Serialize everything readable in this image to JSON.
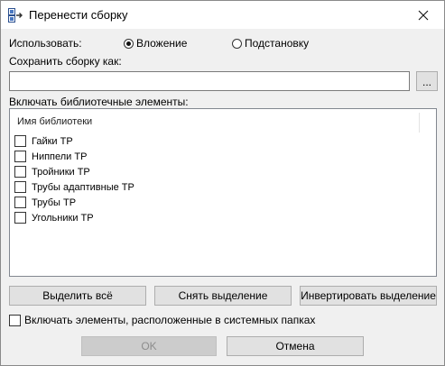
{
  "window": {
    "title": "Перенести сборку",
    "close_symbol": "✕"
  },
  "use": {
    "label": "Использовать:",
    "options": [
      {
        "label": "Вложение",
        "checked": true
      },
      {
        "label": "Подстановку",
        "checked": false
      }
    ]
  },
  "save_as": {
    "label": "Сохранить сборку как:",
    "value": "",
    "browse_label": "..."
  },
  "library": {
    "label": "Включать библиотечные элементы:",
    "column_header": "Имя библиотеки",
    "items": [
      {
        "label": "Гайки ТР",
        "checked": false
      },
      {
        "label": "Ниппели ТР",
        "checked": false
      },
      {
        "label": "Тройники ТР",
        "checked": false
      },
      {
        "label": "Трубы адаптивные ТР",
        "checked": false
      },
      {
        "label": "Трубы ТР",
        "checked": false
      },
      {
        "label": "Угольники ТР",
        "checked": false
      }
    ]
  },
  "actions": {
    "select_all": "Выделить всё",
    "clear_selection": "Снять выделение",
    "invert_selection": "Инвертировать выделение"
  },
  "system_folders": {
    "label": "Включать элементы, расположенные в системных папках",
    "checked": false
  },
  "footer": {
    "ok": "OK",
    "cancel": "Отмена"
  },
  "icons": {
    "app": "assembly-transfer-icon",
    "close": "close-icon"
  }
}
